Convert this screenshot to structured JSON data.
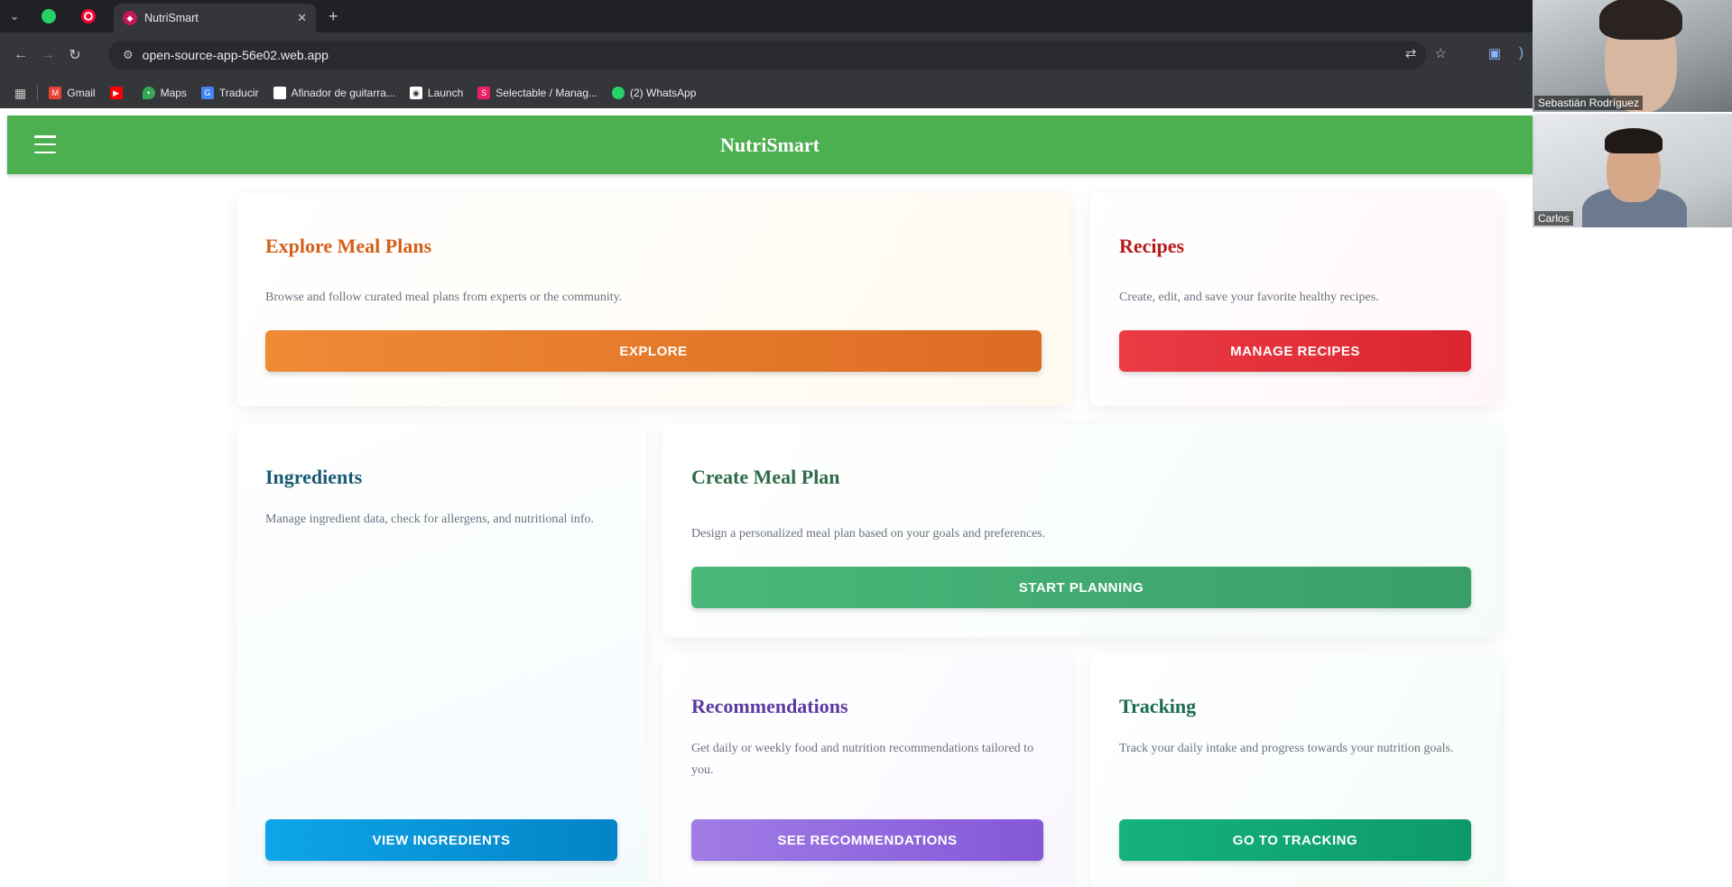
{
  "browser": {
    "tab_title": "NutriSmart",
    "url": "open-source-app-56e02.web.app",
    "bookmarks": [
      "Gmail",
      "",
      "Maps",
      "Traducir",
      "Afinador de guitarra...",
      "Launch",
      "Selectable / Manag...",
      "(2) WhatsApp"
    ]
  },
  "video": {
    "participant1": "Sebastián Rodríguez",
    "participant2": "Carlos"
  },
  "app": {
    "title": "NutriSmart",
    "cards": {
      "explore": {
        "title": "Explore Meal Plans",
        "desc": "Browse and follow curated meal plans from experts or the community.",
        "button": "EXPLORE",
        "color": "#d2601a"
      },
      "recipes": {
        "title": "Recipes",
        "desc": "Create, edit, and save your favorite healthy recipes.",
        "button": "MANAGE RECIPES",
        "color": "#b71c1c"
      },
      "ingredients": {
        "title": "Ingredients",
        "desc": "Manage ingredient data, check for allergens, and nutritional info.",
        "button": "VIEW INGREDIENTS",
        "color": "#1a5a72"
      },
      "create": {
        "title": "Create Meal Plan",
        "desc": "Design a personalized meal plan based on your goals and preferences.",
        "button": "START PLANNING",
        "color": "#2e6b47"
      },
      "recommendations": {
        "title": "Recommendations",
        "desc": "Get daily or weekly food and nutrition recommendations tailored to you.",
        "button": "SEE RECOMMENDATIONS",
        "color": "#5b3aa0"
      },
      "tracking": {
        "title": "Tracking",
        "desc": "Track your daily intake and progress towards your nutrition goals.",
        "button": "GO TO TRACKING",
        "color": "#1b6b50"
      }
    }
  }
}
